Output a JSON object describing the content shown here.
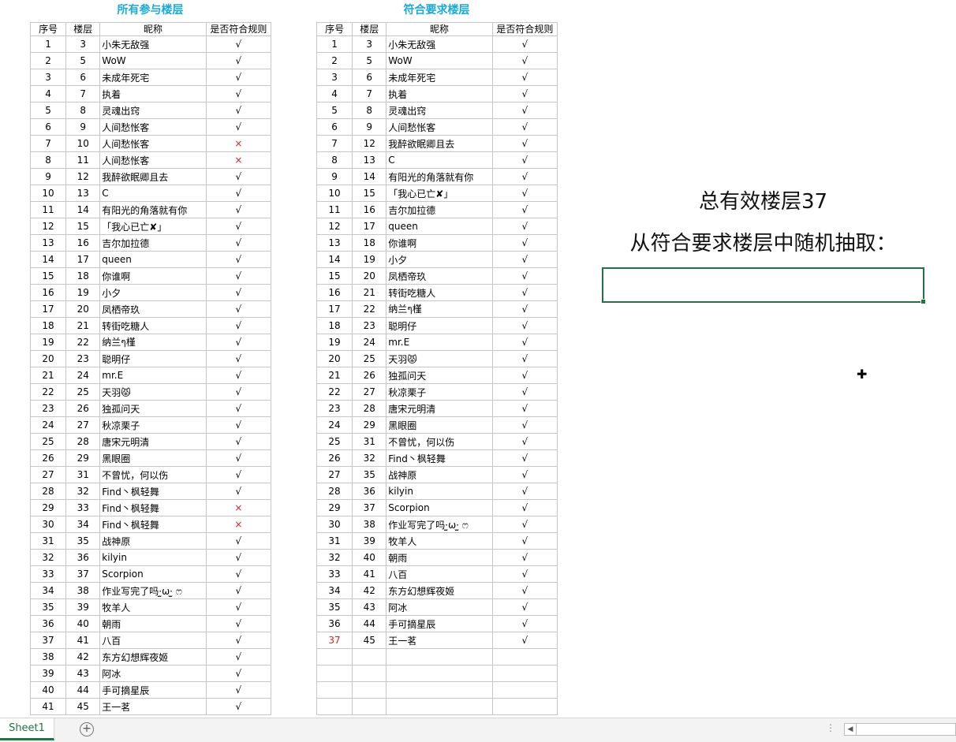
{
  "left_title": "所有参与楼层",
  "right_title": "符合要求楼层",
  "headers": [
    "序号",
    "楼层",
    "昵称",
    "是否符合规则"
  ],
  "all_rows": [
    [
      "1",
      "3",
      "小朱无敌强",
      "√"
    ],
    [
      "2",
      "5",
      "WoW",
      "√"
    ],
    [
      "3",
      "6",
      "未成年死宅",
      "√"
    ],
    [
      "4",
      "7",
      "执着",
      "√"
    ],
    [
      "5",
      "8",
      "灵魂出窍",
      "√"
    ],
    [
      "6",
      "9",
      "人间愁怅客",
      "√"
    ],
    [
      "7",
      "10",
      "人间愁怅客",
      "×"
    ],
    [
      "8",
      "11",
      "人间愁怅客",
      "×"
    ],
    [
      "9",
      "12",
      "我醉欲眠卿且去",
      "√"
    ],
    [
      "10",
      "13",
      "C",
      "√"
    ],
    [
      "11",
      "14",
      "有阳光的角落就有你",
      "√"
    ],
    [
      "12",
      "15",
      "「我心已亡✘」",
      "√"
    ],
    [
      "13",
      "16",
      "吉尔加拉德",
      "√"
    ],
    [
      "14",
      "17",
      "queen",
      "√"
    ],
    [
      "15",
      "18",
      "你谁啊",
      "√"
    ],
    [
      "16",
      "19",
      "小夕",
      "√"
    ],
    [
      "17",
      "20",
      "凤栖帝玖",
      "√"
    ],
    [
      "18",
      "21",
      "转街吃糖人",
      "√"
    ],
    [
      "19",
      "22",
      "纳兰ๆ槿",
      "√"
    ],
    [
      "20",
      "23",
      "聪明仔",
      "√"
    ],
    [
      "21",
      "24",
      "mr.E",
      "√"
    ],
    [
      "22",
      "25",
      "天羽😾",
      "√"
    ],
    [
      "23",
      "26",
      "独孤问天",
      "√"
    ],
    [
      "24",
      "27",
      "秋凉栗子",
      "√"
    ],
    [
      "25",
      "28",
      "唐宋元明清",
      "√"
    ],
    [
      "26",
      "29",
      "黑眼圈",
      "√"
    ],
    [
      "27",
      "31",
      "不曾忧，何以伤",
      "√"
    ],
    [
      "28",
      "32",
      "Find丶枫轻舞",
      "√"
    ],
    [
      "29",
      "33",
      "Find丶枫轻舞",
      "×"
    ],
    [
      "30",
      "34",
      "Find丶枫轻舞",
      "×"
    ],
    [
      "31",
      "35",
      "战神原",
      "√"
    ],
    [
      "32",
      "36",
      "kilyin",
      "√"
    ],
    [
      "33",
      "37",
      "Scorpion",
      "√"
    ],
    [
      "34",
      "38",
      "作业写完了吗·̫ω·̫ ෆ",
      "√"
    ],
    [
      "35",
      "39",
      "牧羊人",
      "√"
    ],
    [
      "36",
      "40",
      "朝雨",
      "√"
    ],
    [
      "37",
      "41",
      "八百",
      "√"
    ],
    [
      "38",
      "42",
      "东方幻想辉夜姬",
      "√"
    ],
    [
      "39",
      "43",
      "阿冰",
      "√"
    ],
    [
      "40",
      "44",
      "手可摘星辰",
      "√"
    ],
    [
      "41",
      "45",
      "王一茗",
      "√"
    ]
  ],
  "valid_rows": [
    [
      "1",
      "3",
      "小朱无敌强",
      "√"
    ],
    [
      "2",
      "5",
      "WoW",
      "√"
    ],
    [
      "3",
      "6",
      "未成年死宅",
      "√"
    ],
    [
      "4",
      "7",
      "执着",
      "√"
    ],
    [
      "5",
      "8",
      "灵魂出窍",
      "√"
    ],
    [
      "6",
      "9",
      "人间愁怅客",
      "√"
    ],
    [
      "7",
      "12",
      "我醉欲眠卿且去",
      "√"
    ],
    [
      "8",
      "13",
      "C",
      "√"
    ],
    [
      "9",
      "14",
      "有阳光的角落就有你",
      "√"
    ],
    [
      "10",
      "15",
      "「我心已亡✘」",
      "√"
    ],
    [
      "11",
      "16",
      "吉尔加拉德",
      "√"
    ],
    [
      "12",
      "17",
      "queen",
      "√"
    ],
    [
      "13",
      "18",
      "你谁啊",
      "√"
    ],
    [
      "14",
      "19",
      "小夕",
      "√"
    ],
    [
      "15",
      "20",
      "凤栖帝玖",
      "√"
    ],
    [
      "16",
      "21",
      "转街吃糖人",
      "√"
    ],
    [
      "17",
      "22",
      "纳兰ๆ槿",
      "√"
    ],
    [
      "18",
      "23",
      "聪明仔",
      "√"
    ],
    [
      "19",
      "24",
      "mr.E",
      "√"
    ],
    [
      "20",
      "25",
      "天羽😾",
      "√"
    ],
    [
      "21",
      "26",
      "独孤问天",
      "√"
    ],
    [
      "22",
      "27",
      "秋凉栗子",
      "√"
    ],
    [
      "23",
      "28",
      "唐宋元明清",
      "√"
    ],
    [
      "24",
      "29",
      "黑眼圈",
      "√"
    ],
    [
      "25",
      "31",
      "不曾忧，何以伤",
      "√"
    ],
    [
      "26",
      "32",
      "Find丶枫轻舞",
      "√"
    ],
    [
      "27",
      "35",
      "战神原",
      "√"
    ],
    [
      "28",
      "36",
      "kilyin",
      "√"
    ],
    [
      "29",
      "37",
      "Scorpion",
      "√"
    ],
    [
      "30",
      "38",
      "作业写完了吗·̫ω·̫ ෆ",
      "√"
    ],
    [
      "31",
      "39",
      "牧羊人",
      "√"
    ],
    [
      "32",
      "40",
      "朝雨",
      "√"
    ],
    [
      "33",
      "41",
      "八百",
      "√"
    ],
    [
      "34",
      "42",
      "东方幻想辉夜姬",
      "√"
    ],
    [
      "35",
      "43",
      "阿冰",
      "√"
    ],
    [
      "36",
      "44",
      "手可摘星辰",
      "√"
    ],
    [
      "37",
      "45",
      "王一茗",
      "√"
    ]
  ],
  "summary_line1": "总有效楼层37",
  "summary_line2": "从符合要求楼层中随机抽取：",
  "draw_result": "",
  "sheet_tab": "Sheet1",
  "icons": {
    "add_sheet": "plus-circle-icon",
    "cursor": "cell-cross-cursor-icon",
    "scroll_left": "triangle-left-icon"
  },
  "colors": {
    "title": "#18a9d9",
    "reject_mark": "#e02020",
    "excel_green": "#217346"
  }
}
